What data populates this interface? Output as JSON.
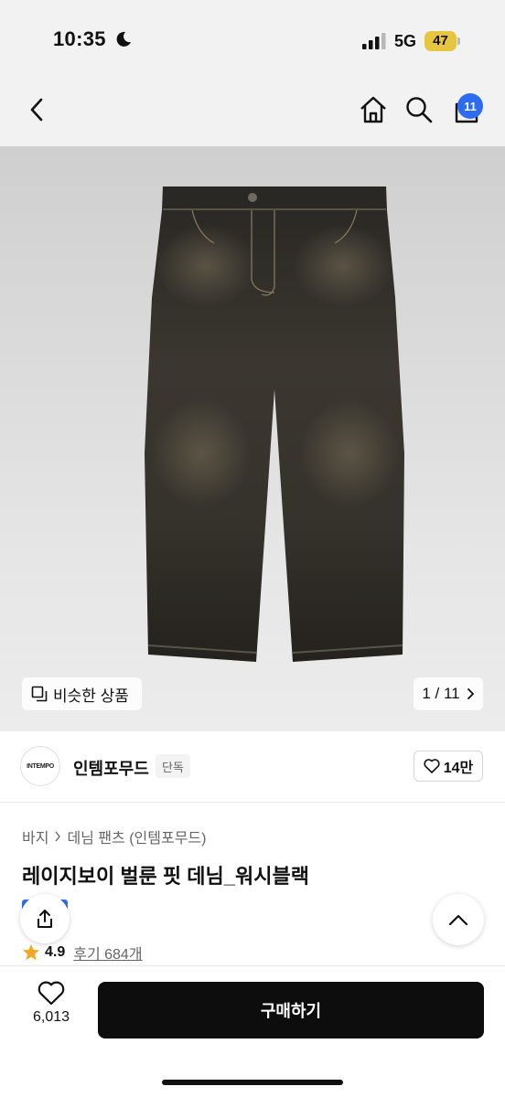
{
  "status_bar": {
    "time": "10:35",
    "network": "5G",
    "battery": "47",
    "battery_color": "#e6c640"
  },
  "nav": {
    "back_icon": "chevron-left-icon",
    "home_icon": "home-icon",
    "search_icon": "search-icon",
    "cart_icon": "shopping-bag-icon",
    "cart_badge": "11",
    "badge_color": "#2d6bf0"
  },
  "gallery": {
    "similar_label": "비슷한 상품",
    "page_indicator": "1 / 11"
  },
  "brand": {
    "logo_text": "INTEMPO",
    "name": "인템포무드",
    "tag": "단독",
    "likes": "14만"
  },
  "product": {
    "breadcrumb": [
      "바지",
      "데님 팬츠 (인템포무드)"
    ],
    "title": "레이지보이 벌룬 핏 데님_워시블랙",
    "rating": "4.9",
    "reviews": "후기 684개"
  },
  "bottom": {
    "wish_count": "6,013",
    "buy_label": "구매하기"
  }
}
